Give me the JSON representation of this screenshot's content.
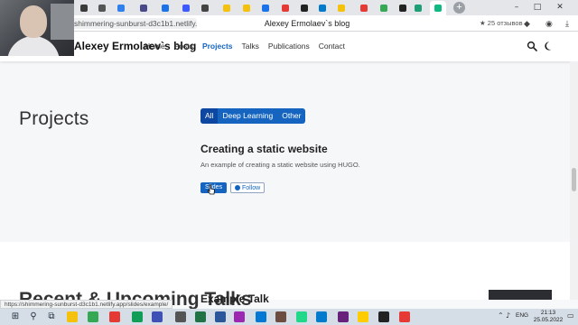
{
  "browser": {
    "tabs": [
      {
        "name": "tab-1",
        "color": "#3b3b3b"
      },
      {
        "name": "tab-2",
        "color": "#555555"
      },
      {
        "name": "tab-3",
        "color": "#2f80ed"
      },
      {
        "name": "tab-4",
        "color": "#4a4a8a"
      },
      {
        "name": "tab-5",
        "color": "#1a73e8"
      },
      {
        "name": "tab-6",
        "color": "#3d5afe"
      },
      {
        "name": "tab-7",
        "color": "#444444"
      },
      {
        "name": "tab-8",
        "color": "#f4c20d"
      },
      {
        "name": "tab-9",
        "color": "#f4c20d"
      },
      {
        "name": "tab-10",
        "color": "#1a73e8"
      },
      {
        "name": "tab-11",
        "color": "#e53935"
      },
      {
        "name": "tab-12",
        "color": "#222222"
      },
      {
        "name": "tab-13",
        "color": "#007acc"
      },
      {
        "name": "tab-14",
        "color": "#f4c20d"
      },
      {
        "name": "tab-15",
        "color": "#e53935"
      },
      {
        "name": "tab-16",
        "color": "#34a853"
      },
      {
        "name": "tab-17",
        "color": "#222222"
      },
      {
        "name": "tab-18",
        "color": "#1d9f75"
      },
      {
        "name": "tab-active",
        "color": "#10b981"
      }
    ],
    "window_controls": {
      "minimize": "–",
      "maximize": "□",
      "close": "✕"
    },
    "url": "shimmering-sunburst-d3c1b1.netlify.app",
    "page_title": "Alexey Ermolaev`s blog",
    "reviews": "★ 25 отзывов",
    "status_url": "https://shimmering-sunburst-d3c1b1.netlify.app/slides/example/"
  },
  "site": {
    "brand": "Alexey Ermolaev`s blog",
    "nav": [
      "Home",
      "Posts",
      "Projects",
      "Talks",
      "Publications",
      "Contact"
    ],
    "active_nav": "Projects"
  },
  "projects": {
    "title": "Projects",
    "filters": [
      "All",
      "Deep Learning",
      "Other"
    ],
    "selected_filter": "All",
    "item": {
      "title": "Creating a static website",
      "description": "An example of creating a static website using HUGO.",
      "slides_label": "Slides",
      "follow_label": "Follow"
    }
  },
  "talks": {
    "title": "Recent & Upcoming Talks",
    "item_title": "Example Talk"
  },
  "taskbar": {
    "language": "ENG",
    "time": "21:13",
    "date": "25.05.2022",
    "apps": [
      {
        "name": "start-button",
        "glyph": "⊞"
      },
      {
        "name": "search-icon",
        "glyph": "⚲"
      },
      {
        "name": "task-view-icon",
        "glyph": "⧉"
      },
      {
        "name": "file-explorer-icon",
        "color": "#f4c20d"
      },
      {
        "name": "chrome-icon",
        "color": "#34a853"
      },
      {
        "name": "yandex-browser-icon",
        "color": "#e53935"
      },
      {
        "name": "edge-icon",
        "color": "#0f9d58"
      },
      {
        "name": "app-icon-1",
        "color": "#3f51b5"
      },
      {
        "name": "store-icon",
        "color": "#555555"
      },
      {
        "name": "excel-icon",
        "color": "#217346"
      },
      {
        "name": "word-icon",
        "color": "#2b579a"
      },
      {
        "name": "app-icon-2",
        "color": "#9c27b0"
      },
      {
        "name": "photos-icon",
        "color": "#0078d4"
      },
      {
        "name": "app-icon-3",
        "color": "#6d4c41"
      },
      {
        "name": "pycharm-icon",
        "color": "#21d789"
      },
      {
        "name": "vscode-icon",
        "color": "#007acc"
      },
      {
        "name": "visual-studio-icon",
        "color": "#68217a"
      },
      {
        "name": "yandex-icon",
        "color": "#ffcc00"
      },
      {
        "name": "terminal-icon",
        "color": "#222222"
      },
      {
        "name": "camera-app-icon",
        "color": "#e53935"
      }
    ]
  }
}
